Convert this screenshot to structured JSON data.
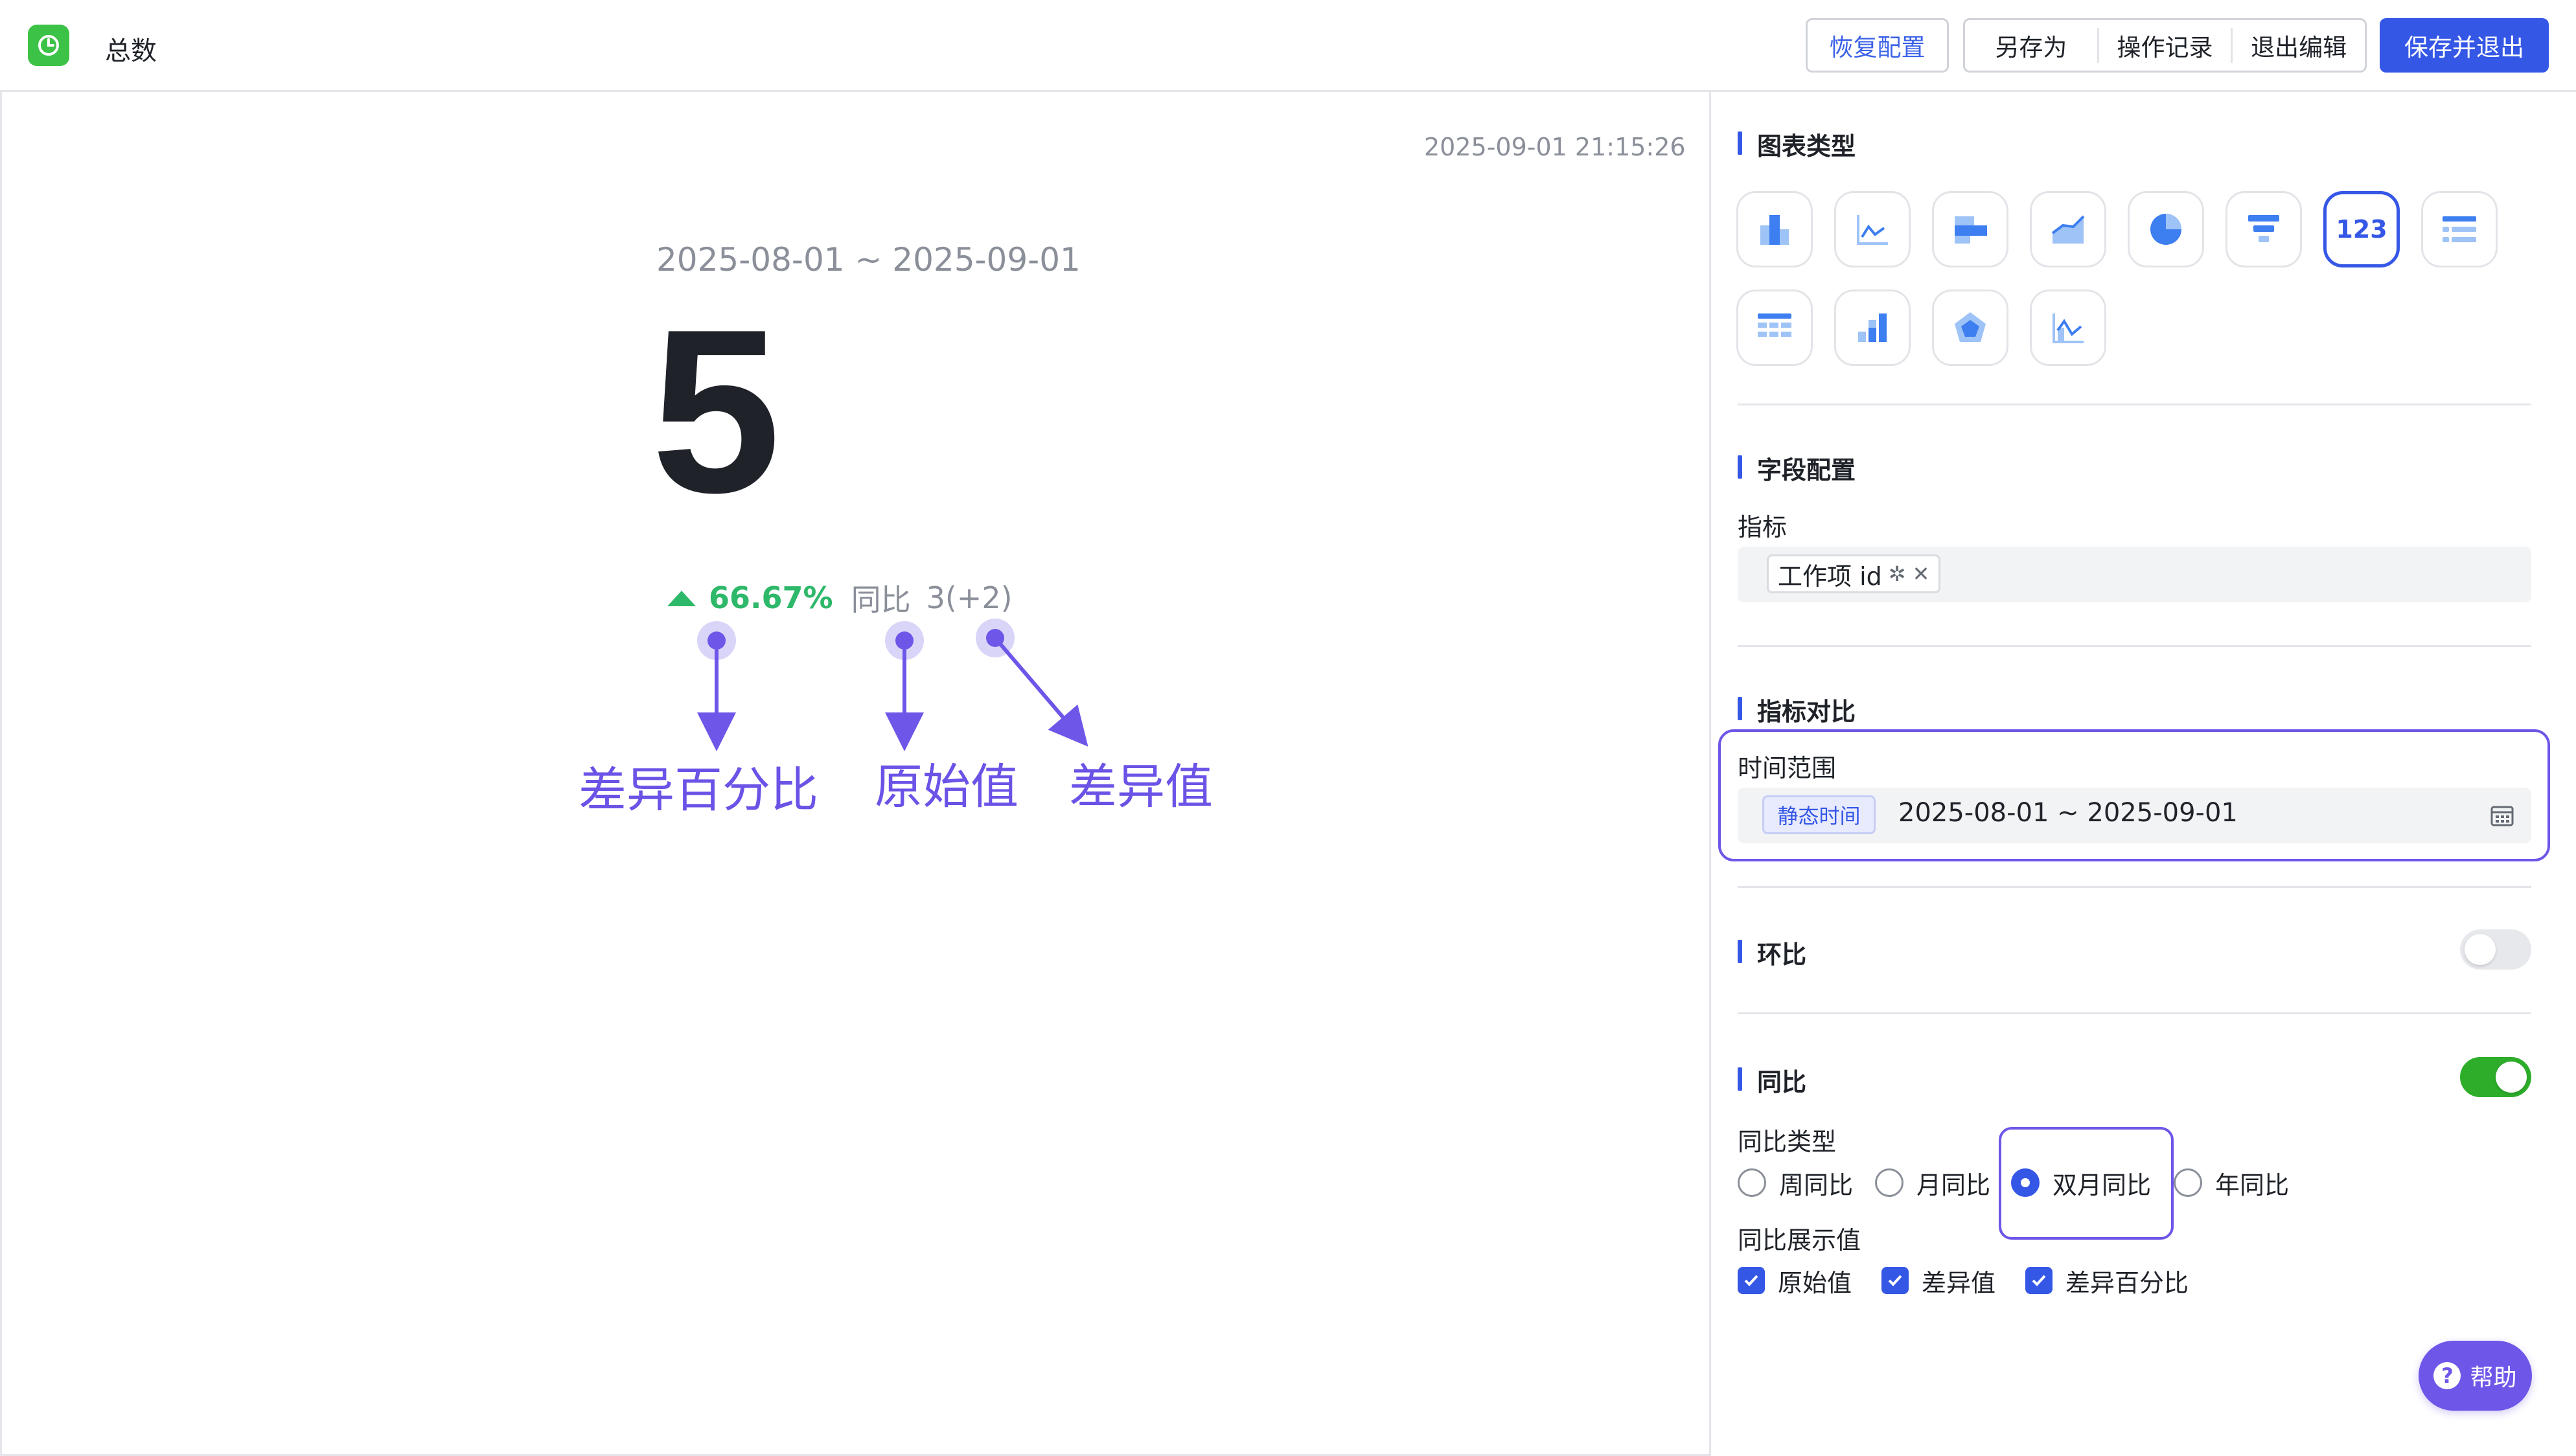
{
  "header": {
    "title": "总数",
    "app_icon": "app-icon",
    "restore_label": "恢复配置",
    "save_as_label": "另存为",
    "history_label": "操作记录",
    "exit_label": "退出编辑",
    "save_exit_label": "保存并退出"
  },
  "preview": {
    "timestamp": "2025-09-01 21:15:26",
    "date_range": "2025-08-01 ~ 2025-09-01",
    "value": "5",
    "change_percent": "66.67%",
    "compare_label": "同比",
    "raw_and_diff": "3(+2)",
    "annotations": {
      "diff_percent": "差异百分比",
      "raw_value": "原始值",
      "diff_value": "差异值"
    }
  },
  "sidebar": {
    "chart_type_title": "图表类型",
    "chart_types": [
      "bar-chart-icon",
      "line-chart-icon",
      "horizontal-bar-icon",
      "area-chart-icon",
      "pie-chart-icon",
      "funnel-chart-icon",
      "number-card-icon",
      "list-icon",
      "table-icon",
      "stacked-bar-icon",
      "radar-chart-icon",
      "combo-chart-icon"
    ],
    "number_card_text": "123",
    "field_config_title": "字段配置",
    "metric_label": "指标",
    "metric_field": "工作项 id",
    "metric_compare_title": "指标对比",
    "time_range_label": "时间范围",
    "static_time_tag": "静态时间",
    "time_range_value": "2025-08-01 ~ 2025-09-01",
    "mom_title": "环比",
    "mom_enabled": false,
    "yoy_title": "同比",
    "yoy_enabled": true,
    "yoy_type_label": "同比类型",
    "yoy_types": [
      {
        "label": "周同比",
        "checked": false
      },
      {
        "label": "月同比",
        "checked": false
      },
      {
        "label": "双月同比",
        "checked": true
      },
      {
        "label": "年同比",
        "checked": false
      }
    ],
    "yoy_display_label": "同比展示值",
    "yoy_display": [
      {
        "label": "原始值",
        "checked": true
      },
      {
        "label": "差异值",
        "checked": true
      },
      {
        "label": "差异百分比",
        "checked": true
      }
    ],
    "help_label": "帮助"
  },
  "colors": {
    "primary": "#3557e6",
    "accent": "#6d56e8",
    "positive": "#2eb86a",
    "toggle_on": "#2dad2a"
  }
}
